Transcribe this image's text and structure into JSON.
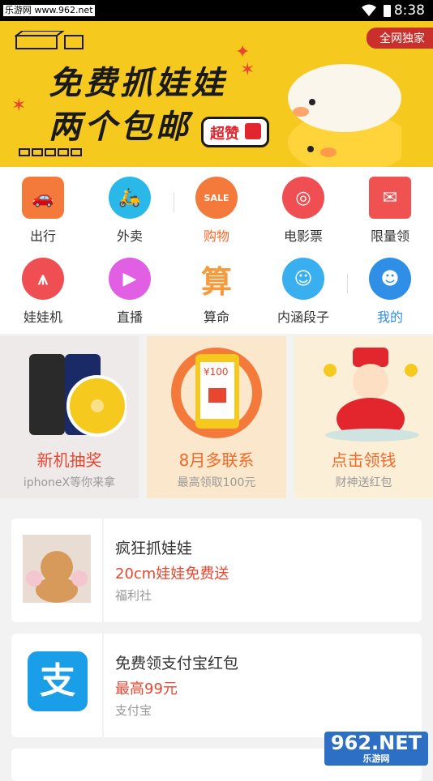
{
  "statusbar": {
    "watermark": "乐游网 www.962.net",
    "time": "8:38"
  },
  "banner": {
    "title_line1": "免费抓娃娃",
    "title_line2": "两个包邮",
    "badge": "超赞",
    "tag": "全网独家"
  },
  "grid": [
    {
      "label": "出行",
      "icon": "car-icon",
      "color": "#f47a3c"
    },
    {
      "label": "外卖",
      "icon": "scooter-icon",
      "color": "#29b8e8"
    },
    {
      "label": "购物",
      "icon": "sale-tag-icon",
      "color": "#f47a3c",
      "active": true
    },
    {
      "label": "电影票",
      "icon": "film-reel-icon",
      "color": "#ef4f52"
    },
    {
      "label": "限量领",
      "icon": "red-envelope-icon",
      "color": "#f05252"
    },
    {
      "label": "娃娃机",
      "icon": "claw-icon",
      "color": "#ef4f52"
    },
    {
      "label": "直播",
      "icon": "video-camera-icon",
      "color": "#e05fe3"
    },
    {
      "label": "算命",
      "icon": "suan-char-icon",
      "color": "#f79a3c",
      "glyph": "算"
    },
    {
      "label": "内涵段子",
      "icon": "smiley-face-icon",
      "color": "#3aaff0"
    },
    {
      "label": "我的",
      "icon": "user-avatar-icon",
      "color": "#2f8ee6"
    }
  ],
  "promos": [
    {
      "title": "新机抽奖",
      "subtitle": "iphoneX等你来拿",
      "bg": "#efeaea",
      "title_color": "#e8462e"
    },
    {
      "title": "8月多联系",
      "subtitle": "最高领取100元",
      "bg": "#fbe8cc",
      "title_color": "#f0692a",
      "amount": "¥100"
    },
    {
      "title": "点击领钱",
      "subtitle": "财神送红包",
      "bg": "#fcefd7",
      "title_color": "#f0692a"
    }
  ],
  "cards": [
    {
      "title": "疯狂抓娃娃",
      "subtitle": "20cm娃娃免费送",
      "source": "福利社"
    },
    {
      "title": "免费领支付宝红包",
      "subtitle": "最高99元",
      "source": "支付宝",
      "logo_glyph": "支"
    }
  ],
  "watermark_logo": {
    "brand": "962.NET",
    "caption": "乐游网"
  }
}
